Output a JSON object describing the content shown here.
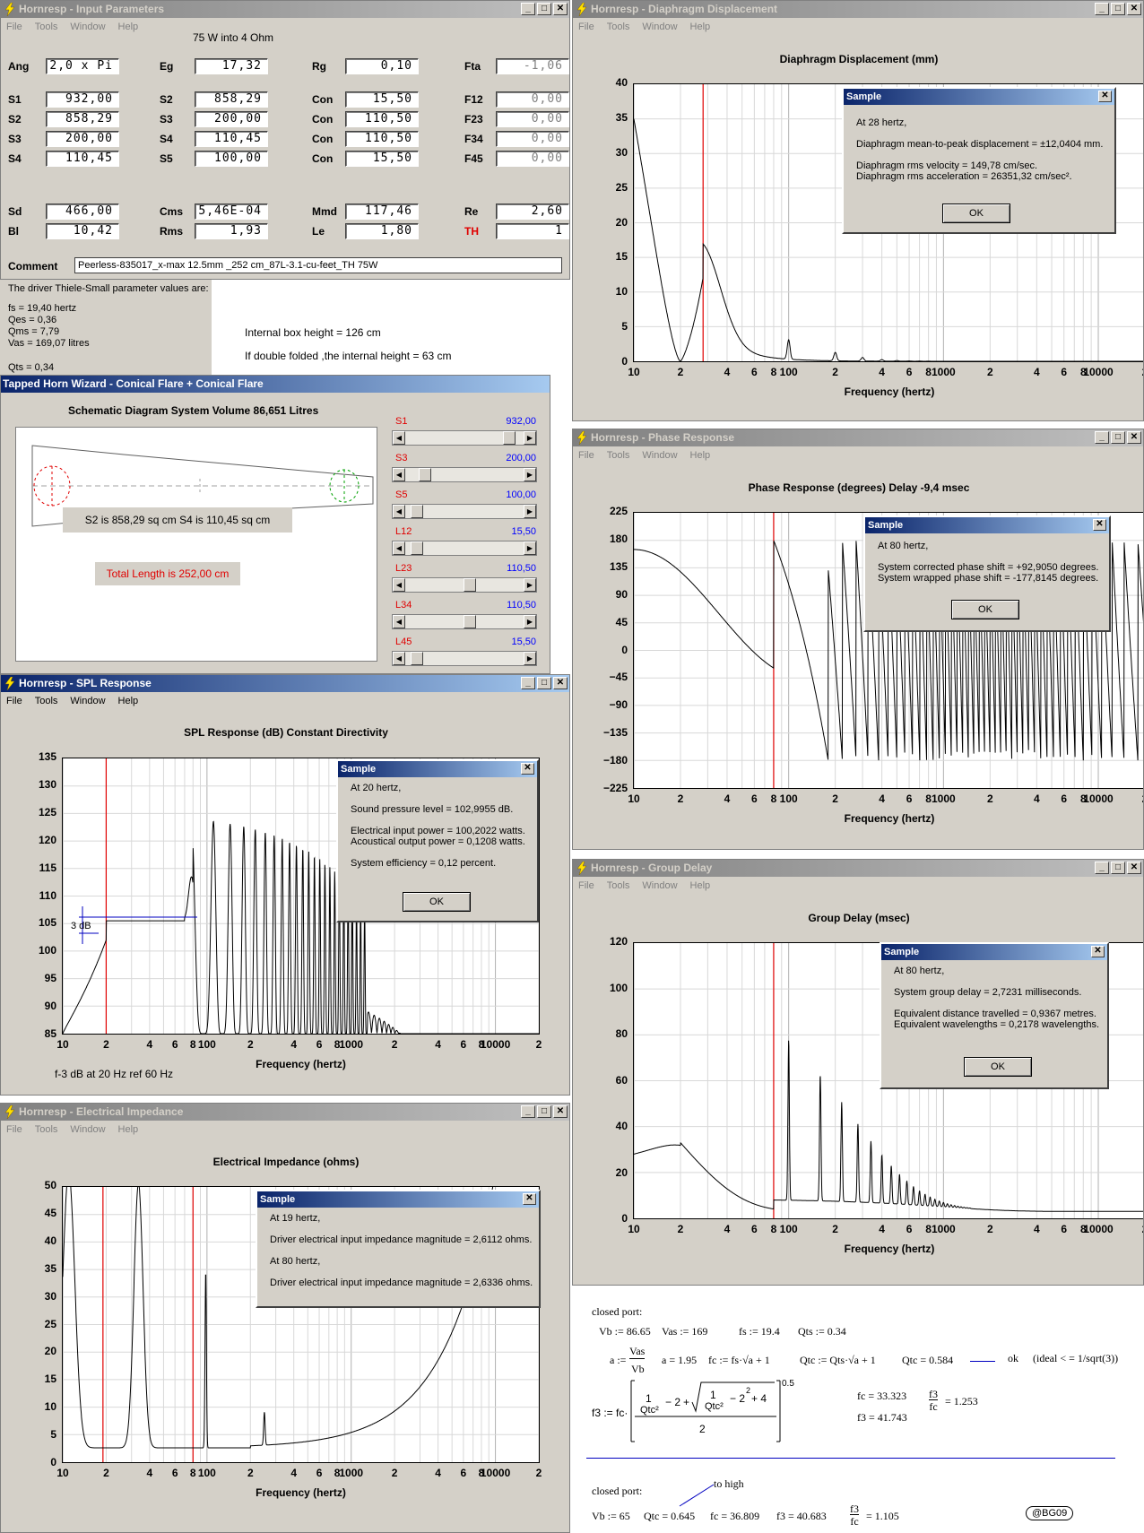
{
  "input_params": {
    "title": "Hornresp - Input Parameters",
    "menu": [
      "File",
      "Tools",
      "Window",
      "Help"
    ],
    "subtitle": "75 W into 4 Ohm",
    "fields": [
      {
        "label": "Ang",
        "value": "2,0 x Pi"
      },
      {
        "label": "Eg",
        "value": "17,32"
      },
      {
        "label": "Rg",
        "value": "0,10"
      },
      {
        "label": "Fta",
        "value": "-1,06"
      },
      {
        "label": "S1",
        "value": "932,00"
      },
      {
        "label": "S2",
        "value": "858,29"
      },
      {
        "label": "Con",
        "value": "15,50"
      },
      {
        "label": "F12",
        "value": "0,00"
      },
      {
        "label": "S2",
        "value": "858,29"
      },
      {
        "label": "S3",
        "value": "200,00"
      },
      {
        "label": "Con",
        "value": "110,50"
      },
      {
        "label": "F23",
        "value": "0,00"
      },
      {
        "label": "S3",
        "value": "200,00"
      },
      {
        "label": "S4",
        "value": "110,45"
      },
      {
        "label": "Con",
        "value": "110,50"
      },
      {
        "label": "F34",
        "value": "0,00"
      },
      {
        "label": "S4",
        "value": "110,45"
      },
      {
        "label": "S5",
        "value": "100,00"
      },
      {
        "label": "Con",
        "value": "15,50"
      },
      {
        "label": "F45",
        "value": "0,00"
      },
      {
        "label": "Sd",
        "value": "466,00"
      },
      {
        "label": "Cms",
        "value": "5,46E-04"
      },
      {
        "label": "Mmd",
        "value": "117,46"
      },
      {
        "label": "Re",
        "value": "2,60"
      },
      {
        "label": "Bl",
        "value": "10,42"
      },
      {
        "label": "Rms",
        "value": "1,93"
      },
      {
        "label": "Le",
        "value": "1,80"
      },
      {
        "label": "TH",
        "value": "1"
      }
    ],
    "comment_label": "Comment",
    "comment": "Peerless-835017_x-max 12.5mm _252 cm_87L-3.1-cu-feet_TH 75W",
    "ts_header": "The driver Thiele-Small parameter values are:",
    "ts_values": [
      "fs = 19,40 hertz",
      "Qes = 0,36",
      "Qms = 7,79",
      "Vas = 169,07 litres",
      "Qts = 0,34"
    ],
    "note1": "Internal box height = 126 cm",
    "note2": "If  double folded ,the internal height = 63 cm"
  },
  "wizard": {
    "title": "Tapped Horn Wizard - Conical Flare + Conical Flare",
    "heading": "Schematic Diagram    System Volume 86,651 Litres",
    "info": "S2 is 858,29 sq cm     S4 is 110,45 sq cm",
    "total": "Total Length is 252,00 cm",
    "sliders": [
      {
        "label": "S1",
        "value": "932,00",
        "pos": 0.92
      },
      {
        "label": "S3",
        "value": "200,00",
        "pos": 0.13
      },
      {
        "label": "S5",
        "value": "100,00",
        "pos": 0.05
      },
      {
        "label": "L12",
        "value": "15,50",
        "pos": 0.05
      },
      {
        "label": "L23",
        "value": "110,50",
        "pos": 0.55
      },
      {
        "label": "L34",
        "value": "110,50",
        "pos": 0.55
      },
      {
        "label": "L45",
        "value": "15,50",
        "pos": 0.05
      }
    ]
  },
  "xticks": [
    "10",
    "2",
    "4",
    "6",
    "8",
    "100",
    "2",
    "4",
    "6",
    "8",
    "1000",
    "2",
    "4",
    "6",
    "8",
    "10000",
    "2"
  ],
  "xlabel": "Frequency (hertz)",
  "diaphragm": {
    "title": "Hornresp - Diaphragm Displacement",
    "menu": [
      "File",
      "Tools",
      "Window",
      "Help"
    ],
    "plot_title": "Diaphragm Displacement (mm)",
    "yticks": [
      "40",
      "35",
      "30",
      "25",
      "20",
      "15",
      "10",
      "5",
      "0"
    ],
    "dialog": {
      "title": "Sample",
      "lines": [
        "At 28 hertz,",
        "Diaphragm mean-to-peak displacement = ±12,0404 mm.",
        "Diaphragm rms velocity = 149,78 cm/sec.",
        "Diaphragm rms acceleration = 26351,32 cm/sec².",
        "OK"
      ]
    }
  },
  "phase": {
    "title": "Hornresp - Phase Response",
    "menu": [
      "File",
      "Tools",
      "Window",
      "Help"
    ],
    "plot_title": "Phase Response (degrees)    Delay -9,4 msec",
    "yticks": [
      "225",
      "180",
      "135",
      "90",
      "45",
      "0",
      "−45",
      "−90",
      "−135",
      "−180",
      "−225"
    ],
    "dialog": {
      "title": "Sample",
      "lines": [
        "At 80 hertz,",
        "System corrected phase shift = +92,9050 degrees.",
        "System wrapped phase shift = -177,8145 degrees.",
        "OK"
      ]
    }
  },
  "spl": {
    "title": "Hornresp - SPL Response",
    "menu": [
      "File",
      "Tools",
      "Window",
      "Help"
    ],
    "plot_title": "SPL Response (dB)    Constant Directivity",
    "yticks": [
      "135",
      "130",
      "125",
      "120",
      "115",
      "110",
      "105",
      "100",
      "95",
      "90",
      "85"
    ],
    "annot": "3 dB",
    "footer": "f-3 dB at 20 Hz ref 60 Hz",
    "dialog": {
      "title": "Sample",
      "lines": [
        "At 20 hertz,",
        "Sound pressure level = 102,9955 dB.",
        "Electrical input power = 100,2022 watts.",
        "Acoustical output power = 0,1208 watts.",
        "System efficiency = 0,12 percent.",
        "OK"
      ]
    }
  },
  "group": {
    "title": "Hornresp - Group Delay",
    "menu": [
      "File",
      "Tools",
      "Window",
      "Help"
    ],
    "plot_title": "Group Delay (msec)",
    "yticks": [
      "120",
      "100",
      "80",
      "60",
      "40",
      "20",
      "0"
    ],
    "dialog": {
      "title": "Sample",
      "lines": [
        "At 80 hertz,",
        "System group delay = 2,7231 milliseconds.",
        "Equivalent distance travelled = 0,9367 metres.",
        "Equivalent wavelengths = 0,2178 wavelengths.",
        "OK"
      ]
    }
  },
  "impedance": {
    "title": "Hornresp - Electrical Impedance",
    "menu": [
      "File",
      "Tools",
      "Window",
      "Help"
    ],
    "plot_title": "Electrical Impedance (ohms)",
    "yticks": [
      "50",
      "45",
      "40",
      "35",
      "30",
      "25",
      "20",
      "15",
      "10",
      "5",
      "0"
    ],
    "dialog": {
      "title": "Sample",
      "lines": [
        "At 19 hertz,",
        "Driver electrical input impedance magnitude = 2,6112 ohms.",
        "At 80 hertz,",
        "Driver electrical input impedance magnitude = 2,6336 ohms."
      ]
    }
  },
  "mathcad": {
    "h1": "closed port:",
    "vb": "Vb := 86.65",
    "vas": "Vas := 169",
    "fs": "fs := 19.4",
    "qts": "Qts := 0.34",
    "a_def": "a :=",
    "a_num": "Vas",
    "a_den": "Vb",
    "a_val": "a = 1.95",
    "fc_def": "fc := fs·√a + 1",
    "qtc_def": "Qtc := Qts·√a + 1",
    "qtc_val": "Qtc = 0.584",
    "ok": "ok",
    "ideal": "(ideal < = 1/sqrt(3))",
    "fc_val": "fc = 33.323",
    "f3_val": "f3 = 41.743",
    "ratio_val": "= 1.253",
    "f3_def": "f3 := fc·",
    "h2": "closed port:",
    "to_high": "to high",
    "vb2": "Vb := 65",
    "qtc2": "Qtc = 0.645",
    "fc2": "fc = 36.809",
    "f3_2": "f3 = 40.683",
    "ratio2": "= 1.105",
    "sig": "@BG09"
  }
}
